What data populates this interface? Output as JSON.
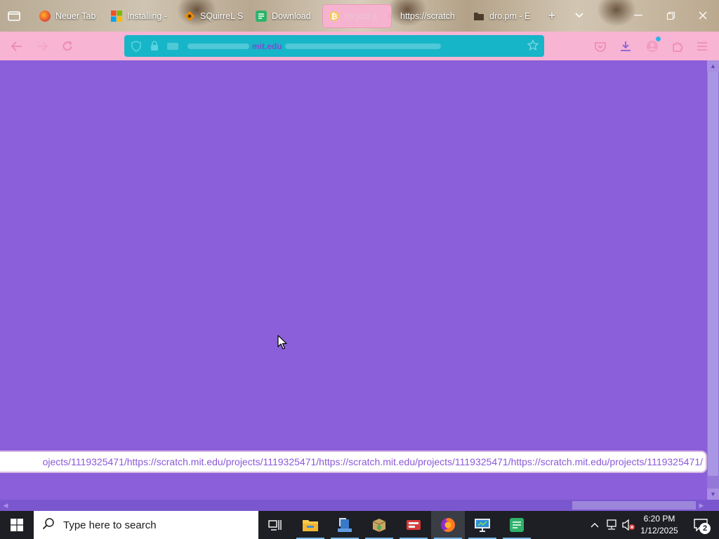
{
  "tabs": [
    {
      "label": "Neuer Tab",
      "icon": "firefox-icon",
      "color": "#e8542c"
    },
    {
      "label": "Installing -",
      "icon": "microsoft-icon",
      "color": "#00a4ef"
    },
    {
      "label": "SQuirreL S",
      "icon": "squirrel-icon",
      "color": "#f08c00"
    },
    {
      "label": "Download",
      "icon": "notepad-icon",
      "color": "#2fb36b"
    },
    {
      "label": "its just a",
      "icon": "bitcoin-icon",
      "color": "#f2a900",
      "active": true
    },
    {
      "label": "https://scratch",
      "icon": "none"
    },
    {
      "label": "dro.pm - E",
      "icon": "folder-icon",
      "color": "#5a4a34"
    }
  ],
  "urlbar": {
    "url_text": "mit.edu"
  },
  "statusbar": {
    "link_text": "ojects/1119325471/https://scratch.mit.edu/projects/1119325471/https://scratch.mit.edu/projects/1119325471/https://scratch.mit.edu/projects/1119325471/"
  },
  "taskbar": {
    "search_placeholder": "Type here to search",
    "clock_time": "6:20 PM",
    "clock_date": "1/12/2025",
    "notification_count": "2"
  },
  "colors": {
    "page_background": "#8a5fd9",
    "toolbar": "#f7b4d3",
    "urlbar": "#17b5c8",
    "status_link_text": "#8c58d8"
  }
}
